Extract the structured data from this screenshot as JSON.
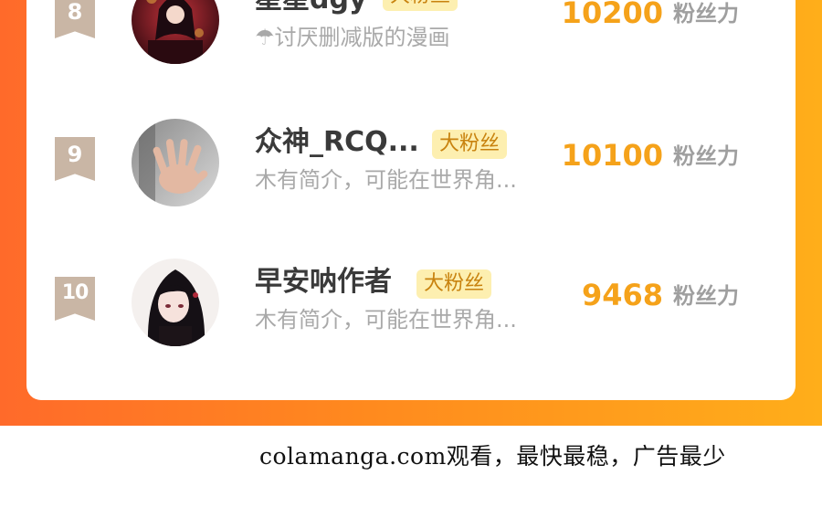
{
  "ranking": {
    "badge_label": "大粉丝",
    "score_unit": "粉丝力",
    "entries": [
      {
        "rank": "8",
        "name": "星星dgy",
        "bio": "☂讨厌删减版的漫画",
        "score": "10200"
      },
      {
        "rank": "9",
        "name": "众神_RCQ...",
        "bio": "木有简介，可能在世界角...",
        "score": "10100"
      },
      {
        "rank": "10",
        "name": "早安呐作者",
        "bio": "木有简介，可能在世界角...",
        "score": "9468"
      }
    ]
  },
  "footer": {
    "watermark": "colamanga.com观看，最快最稳，广告最少"
  },
  "colors": {
    "accent_orange": "#ff6a2a",
    "score_gold": "#f5a21a",
    "badge_bg": "#fdefb0",
    "rank_tag": "#c9b6a5"
  }
}
